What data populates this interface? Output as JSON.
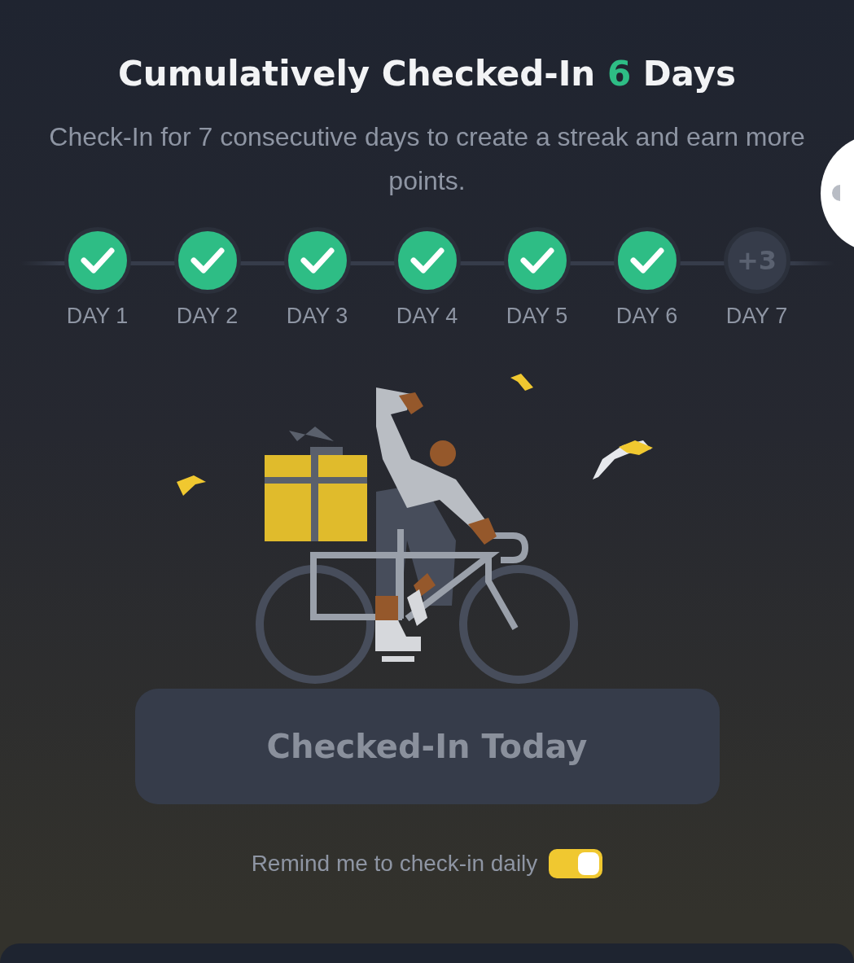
{
  "header": {
    "title_start": "Cumulatively Checked-In",
    "count": "6",
    "title_end": "Days",
    "subtitle": "Check-In for 7 consecutive days to create a streak and earn more points."
  },
  "days": [
    {
      "label": "DAY 1",
      "checked": true
    },
    {
      "label": "DAY 2",
      "checked": true
    },
    {
      "label": "DAY 3",
      "checked": true
    },
    {
      "label": "DAY 4",
      "checked": true
    },
    {
      "label": "DAY 5",
      "checked": true
    },
    {
      "label": "DAY 6",
      "checked": true
    },
    {
      "label": "DAY 7",
      "checked": false,
      "bonus": "+3"
    }
  ],
  "checkin_button": {
    "label": "Checked-In Today",
    "disabled": true
  },
  "reminder": {
    "label": "Remind me to check-in daily",
    "on": true
  }
}
